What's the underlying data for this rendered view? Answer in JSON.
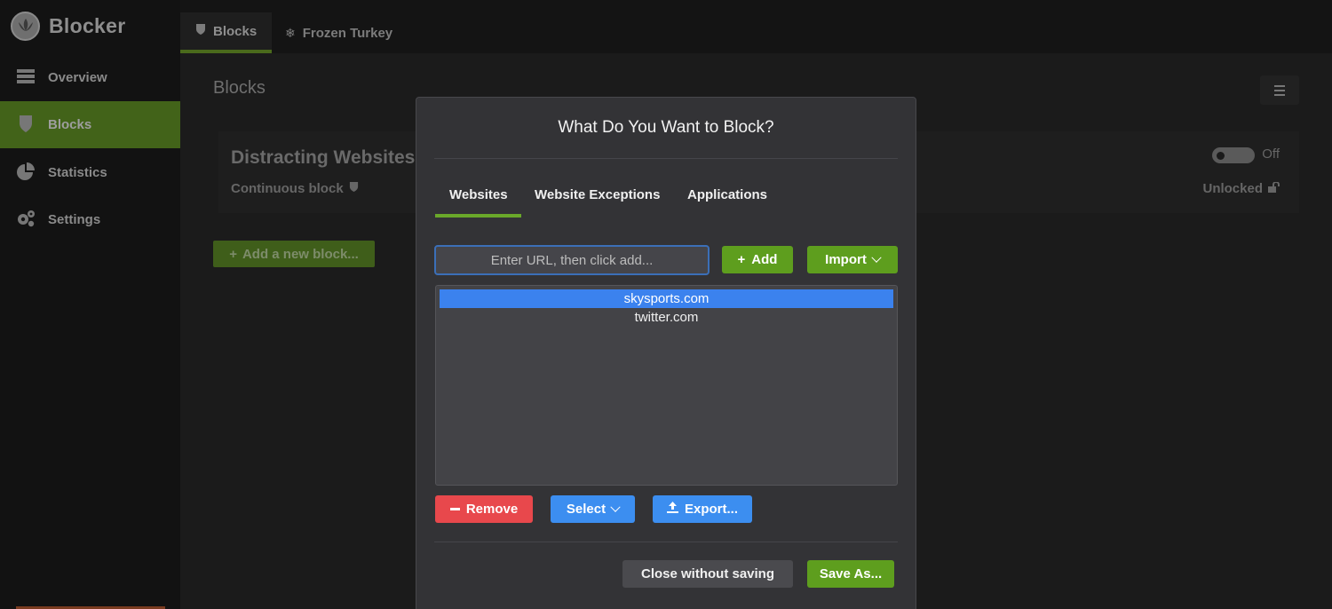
{
  "app": {
    "title": "Blocker"
  },
  "sidebar": {
    "items": [
      {
        "label": "Overview",
        "icon": "overview-icon"
      },
      {
        "label": "Blocks",
        "icon": "shield-icon",
        "active": true
      },
      {
        "label": "Statistics",
        "icon": "pie-chart-icon"
      },
      {
        "label": "Settings",
        "icon": "gears-icon"
      }
    ]
  },
  "topbar": {
    "tabs": [
      {
        "label": "Blocks",
        "icon": "shield-icon",
        "active": true
      },
      {
        "label": "Frozen Turkey",
        "icon": "snowflake-icon"
      }
    ]
  },
  "main": {
    "title": "Blocks",
    "block": {
      "name": "Distracting Websites",
      "mode": "Continuous block",
      "toggle_label": "Off",
      "lock_status": "Unlocked"
    },
    "add_block_label": "Add a new block..."
  },
  "modal": {
    "title": "What Do You Want to Block?",
    "tabs": [
      {
        "label": "Websites",
        "active": true
      },
      {
        "label": "Website Exceptions"
      },
      {
        "label": "Applications"
      }
    ],
    "url_input": {
      "placeholder": "Enter URL, then click add...",
      "value": ""
    },
    "add_label": "Add",
    "import_label": "Import",
    "sites": [
      {
        "label": "skysports.com",
        "selected": true
      },
      {
        "label": "twitter.com",
        "selected": false
      }
    ],
    "remove_label": "Remove",
    "select_label": "Select",
    "export_label": "Export...",
    "close_label": "Close without saving",
    "save_label": "Save As..."
  },
  "colors": {
    "accent_green": "#5e9e1e",
    "selection_blue": "#3b82ee",
    "danger_red": "#e8484c",
    "action_blue": "#3c8ef0"
  }
}
